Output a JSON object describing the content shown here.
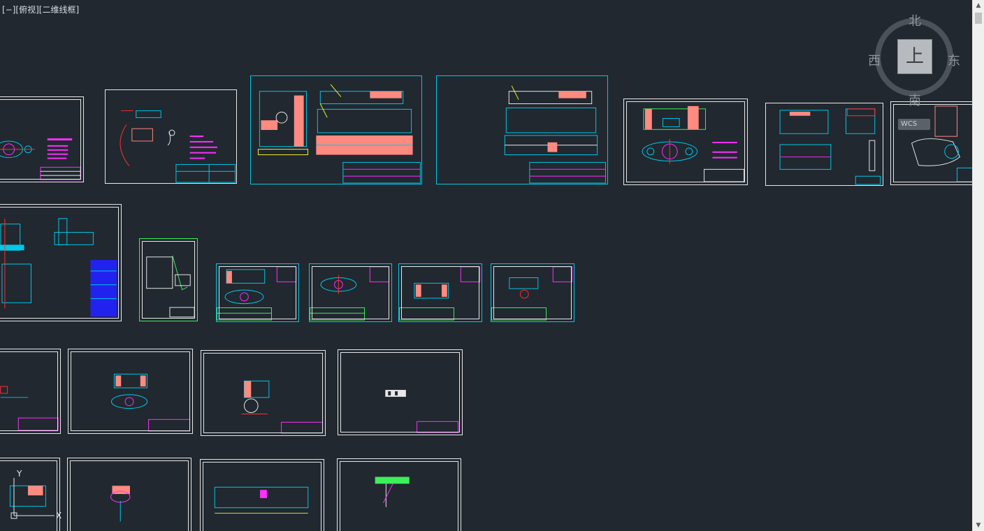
{
  "viewport": {
    "label": "[−][俯视][二维线框]",
    "background": "#212830"
  },
  "navcube": {
    "north": "北",
    "south": "南",
    "east": "东",
    "west": "西",
    "face": "上",
    "wcs": "WCS"
  },
  "ucs_icon": {
    "y_axis": "Y",
    "x_axis": "X"
  },
  "scrollbar": {
    "up": "▲",
    "down": "▼"
  },
  "colors": {
    "cyan": "#00c8e6",
    "magenta": "#ff30ff",
    "salmon": "#ff8a80",
    "yellow": "#f0f030",
    "green": "#3cf05a",
    "white": "#e8e8e8",
    "red": "#ff3030"
  }
}
